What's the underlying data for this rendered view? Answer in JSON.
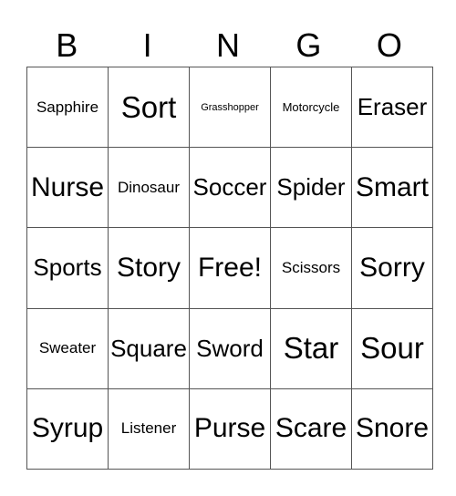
{
  "header": [
    "B",
    "I",
    "N",
    "G",
    "O"
  ],
  "rows": [
    [
      {
        "t": "Sapphire",
        "s": "s16"
      },
      {
        "t": "Sort",
        "s": "s30"
      },
      {
        "t": "Grasshopper",
        "s": "s11"
      },
      {
        "t": "Motorcycle",
        "s": "s13"
      },
      {
        "t": "Eraser",
        "s": "s24"
      }
    ],
    [
      {
        "t": "Nurse",
        "s": "s28"
      },
      {
        "t": "Dinosaur",
        "s": "s16"
      },
      {
        "t": "Soccer",
        "s": "s24"
      },
      {
        "t": "Spider",
        "s": "s24"
      },
      {
        "t": "Smart",
        "s": "s28"
      }
    ],
    [
      {
        "t": "Sports",
        "s": "s24"
      },
      {
        "t": "Story",
        "s": "s28"
      },
      {
        "t": "Free!",
        "s": "s28"
      },
      {
        "t": "Scissors",
        "s": "s16"
      },
      {
        "t": "Sorry",
        "s": "s28"
      }
    ],
    [
      {
        "t": "Sweater",
        "s": "s16"
      },
      {
        "t": "Square",
        "s": "s24"
      },
      {
        "t": "Sword",
        "s": "s24"
      },
      {
        "t": "Star",
        "s": "s30"
      },
      {
        "t": "Sour",
        "s": "s30"
      }
    ],
    [
      {
        "t": "Syrup",
        "s": "s28"
      },
      {
        "t": "Listener",
        "s": "s16"
      },
      {
        "t": "Purse",
        "s": "s28"
      },
      {
        "t": "Scare",
        "s": "s28"
      },
      {
        "t": "Snore",
        "s": "s28"
      }
    ]
  ]
}
